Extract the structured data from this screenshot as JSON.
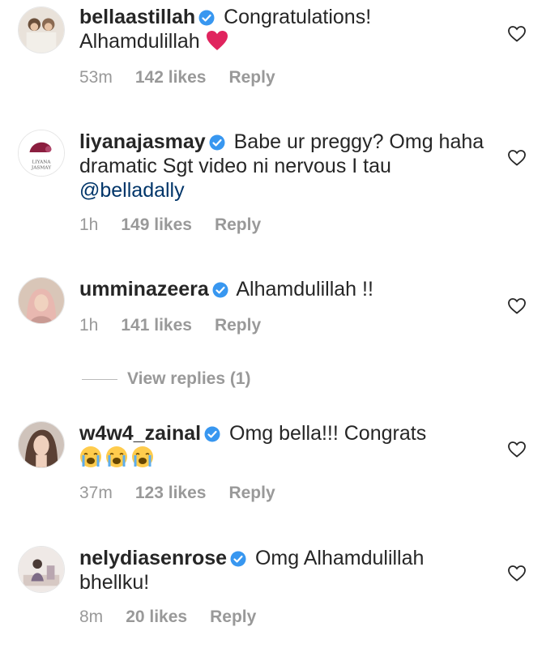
{
  "comments": [
    {
      "username": "bellaastillah",
      "text": "Congratulations! Alhamdulillah",
      "emoji": "red-heart",
      "time": "53m",
      "likes": "142 likes",
      "reply": "Reply"
    },
    {
      "username": "liyanajasmay",
      "text": "Babe ur preggy? Omg haha dramatic Sgt video ni nervous I tau",
      "mention": "@belladally",
      "avatar_text": "LIYANA JASMAY",
      "time": "1h",
      "likes": "149 likes",
      "reply": "Reply"
    },
    {
      "username": "umminazeera",
      "text": "Alhamdulillah !!",
      "time": "1h",
      "likes": "141 likes",
      "reply": "Reply",
      "view_replies": "View replies (1)"
    },
    {
      "username": "w4w4_zainal",
      "text": "Omg bella!!! Congrats",
      "emoji": "loudly-crying-face ×3",
      "time": "37m",
      "likes": "123 likes",
      "reply": "Reply"
    },
    {
      "username": "nelydiasenrose",
      "text": "Omg Alhamdulillah bhellku!",
      "time": "8m",
      "likes": "20 likes",
      "reply": "Reply"
    }
  ],
  "colors": {
    "text": "#262626",
    "meta": "#999999",
    "mention": "#003569",
    "verified": "#3897f0",
    "heart_emoji": "#e0245e"
  }
}
